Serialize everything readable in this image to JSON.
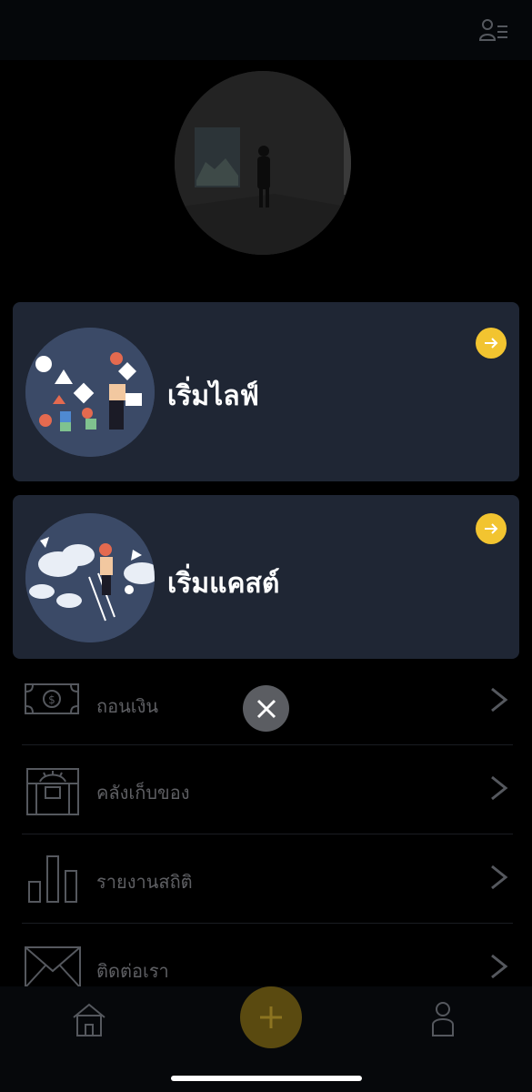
{
  "header": {
    "profile_menu_icon": "person-list-icon"
  },
  "avatar": {
    "description_icon": "gallery-photo"
  },
  "cards": [
    {
      "title": "เริ่มไลฟ์",
      "arrow_icon": "arrow-right-icon"
    },
    {
      "title": "เริ่มแคสต์",
      "arrow_icon": "arrow-right-icon"
    }
  ],
  "menu": [
    {
      "label": "ถอนเงิน",
      "icon": "banknote-icon"
    },
    {
      "label": "คลังเก็บของ",
      "icon": "treasure-chest-icon"
    },
    {
      "label": "รายงานสถิติ",
      "icon": "bar-chart-icon"
    },
    {
      "label": "ติดต่อเรา",
      "icon": "envelope-icon"
    }
  ],
  "overlay": {
    "close_icon": "close-icon"
  },
  "bottom_nav": {
    "home_icon": "home-icon",
    "add_icon": "plus-icon",
    "profile_icon": "person-icon"
  },
  "colors": {
    "card_bg": "#1f2634",
    "accent": "#f2c430",
    "muted_text": "#5e5f63"
  }
}
